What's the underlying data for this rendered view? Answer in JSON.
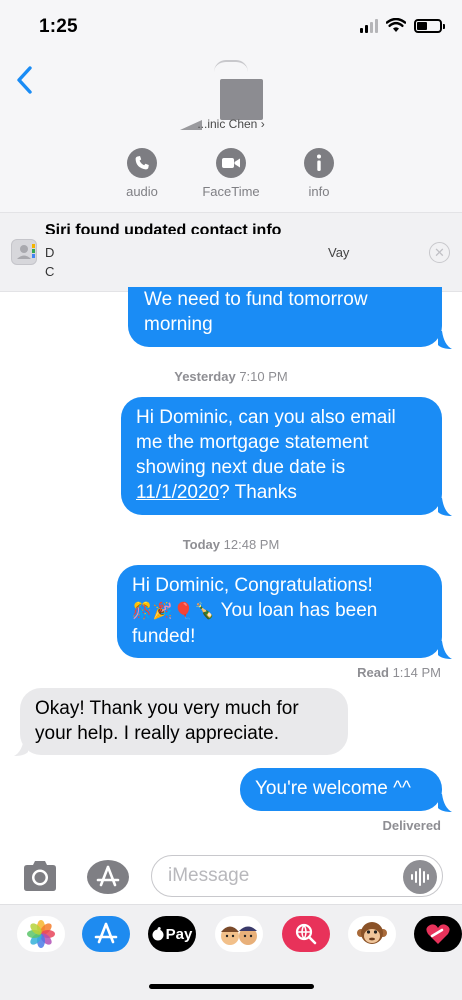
{
  "status_bar": {
    "time": "1:25"
  },
  "contact": {
    "name_fragment": "...inic Chen"
  },
  "actions": [
    {
      "label": "audio",
      "icon": "phone-icon"
    },
    {
      "label": "FaceTime",
      "icon": "video-camera-icon"
    },
    {
      "label": "info",
      "icon": "info-icon"
    }
  ],
  "siri_banner": {
    "title": "Siri found updated contact info",
    "line1_start": "D",
    "line1_end": "Vay",
    "line2": "C"
  },
  "messages": {
    "m1": {
      "direction": "outgoing",
      "line1": "We need to fund tomorrow",
      "line2": "morning"
    },
    "ts1": {
      "day": "Yesterday",
      "time": "7:10 PM"
    },
    "m2": {
      "direction": "outgoing",
      "line1": "Hi Dominic, can you also email",
      "line2": "me the mortgage statement",
      "line3": "showing next due date is",
      "date_link": "11/1/2020",
      "line4_rest": "? Thanks"
    },
    "ts2": {
      "day": "Today",
      "time": "12:48 PM"
    },
    "m3": {
      "direction": "outgoing",
      "line1": "Hi Dominic, Congratulations!",
      "emoji": "🎊🎉🎈🍾",
      "line2_rest": "You loan has been",
      "line3": "funded!"
    },
    "receipt_read": {
      "label": "Read",
      "time": "1:14 PM"
    },
    "m4": {
      "direction": "incoming",
      "line1": "Okay!  Thank you very much for",
      "line2": "your help.  I really appreciate."
    },
    "m5": {
      "direction": "outgoing",
      "text": "You're welcome ^^"
    },
    "receipt_delivered": {
      "label": "Delivered"
    }
  },
  "input": {
    "placeholder": "iMessage"
  },
  "tray": [
    {
      "name": "photos-app-icon",
      "label": ""
    },
    {
      "name": "app-store-icon",
      "label": ""
    },
    {
      "name": "apple-pay-icon",
      "label": "Pay"
    },
    {
      "name": "memoji-icon",
      "label": ""
    },
    {
      "name": "web-search-icon",
      "label": ""
    },
    {
      "name": "monkey-animoji-icon",
      "label": ""
    },
    {
      "name": "digital-touch-icon",
      "label": ""
    }
  ],
  "colors": {
    "accent": "#1a8cf5",
    "incoming_bubble": "#e9e9eb",
    "muted": "#8e8e93"
  }
}
